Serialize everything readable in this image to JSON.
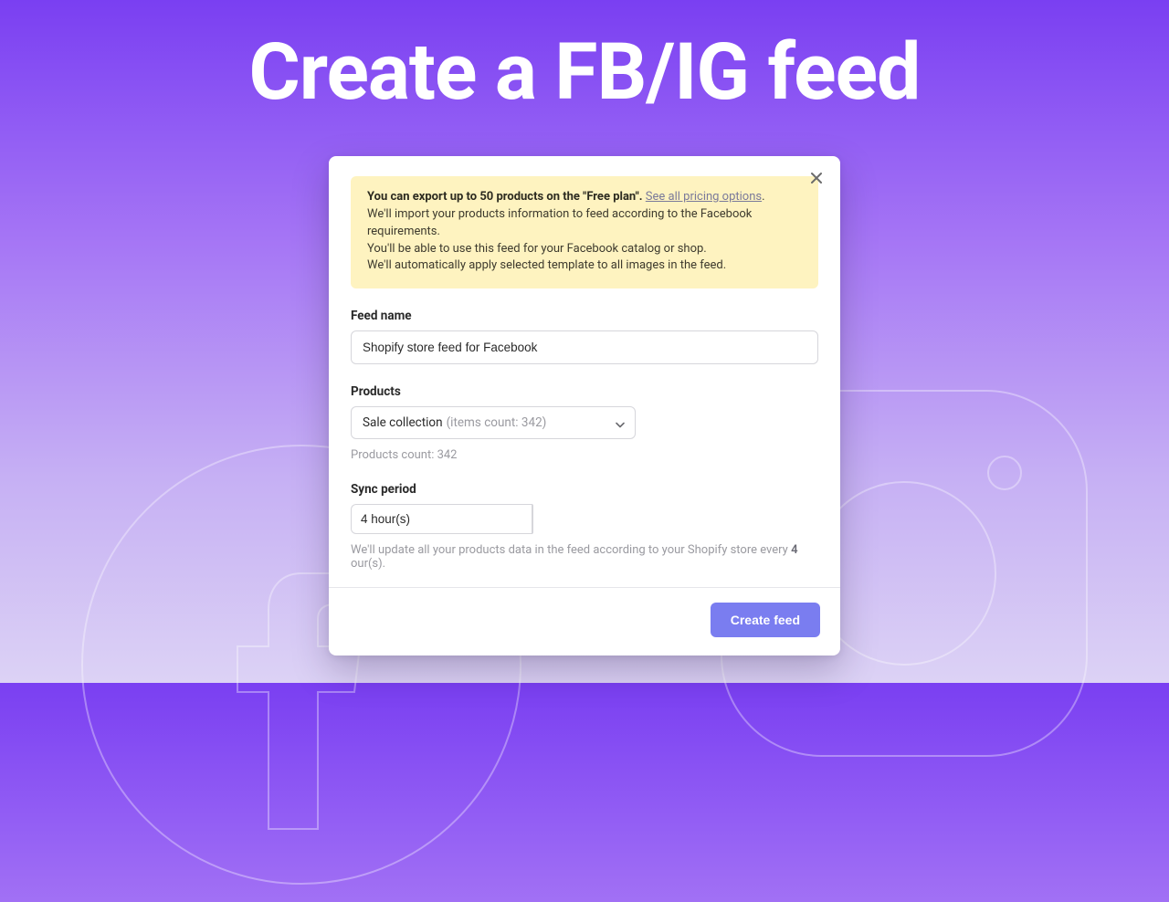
{
  "page": {
    "title": "Create a FB/IG feed"
  },
  "notice": {
    "line1_prefix": "You can export up to 50 products on the \"Free plan\".",
    "link": "See all pricing options",
    "line1_suffix": ".",
    "line2": "We'll import your products information to feed according to the Facebook requirements.",
    "line3": "You'll be able to use this feed for your Facebook catalog or shop.",
    "line4": "We'll automatically apply selected template to all images in the feed."
  },
  "feed_name": {
    "label": "Feed name",
    "value": "Shopify store feed for Facebook"
  },
  "products": {
    "label": "Products",
    "selected_name": "Sale collection",
    "selected_meta": "(items count: 342)",
    "count_text": "Products count: 342"
  },
  "sync": {
    "label": "Sync period",
    "value": "4 hour(s)",
    "helper_prefix": "We'll update all your products data in the feed according to your Shopify store every ",
    "helper_value": "4",
    "helper_suffix": " our(s)."
  },
  "footer": {
    "create_label": "Create feed"
  }
}
